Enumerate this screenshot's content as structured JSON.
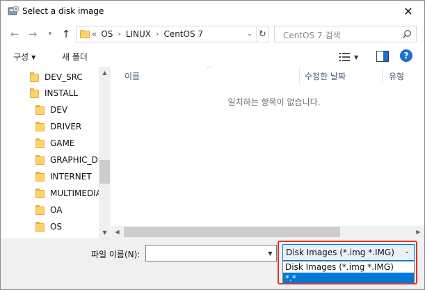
{
  "window": {
    "title": "Select a disk image",
    "close_glyph": "✕"
  },
  "nav": {
    "back_icon": "←",
    "forward_icon": "→",
    "recent_icon": "▾",
    "up_icon": "↑",
    "address": {
      "overflow": "«",
      "crumbs": [
        "OS",
        "LINUX",
        "CentOS 7"
      ],
      "separator": "›",
      "dropdown_icon": "⌄",
      "refresh_icon": "↻"
    },
    "search": {
      "placeholder": "CentOS 7 검색"
    }
  },
  "toolbar": {
    "organize_label": "구성",
    "organize_caret": "▼",
    "new_folder_label": "새 폴더",
    "view_caret": "▼",
    "help_label": "?"
  },
  "sidebar": {
    "items": [
      {
        "label": "DEV_SRC"
      },
      {
        "label": "INSTALL"
      },
      {
        "label": "DEV"
      },
      {
        "label": "DRIVER"
      },
      {
        "label": "GAME"
      },
      {
        "label": "GRAPHIC_DE"
      },
      {
        "label": "INTERNET"
      },
      {
        "label": "MULTIMEDIA"
      },
      {
        "label": "OA"
      },
      {
        "label": "OS"
      }
    ],
    "scroll_up": "▲",
    "scroll_down": "▼"
  },
  "filelist": {
    "columns": {
      "name": "이름",
      "date": "수정한 날짜",
      "type": "유형"
    },
    "sort_indicator": "^",
    "empty_message": "일치하는 항목이 없습니다.",
    "scroll_left": "◀",
    "scroll_right": "▶"
  },
  "bottom": {
    "filename_label": "파일 이름(N):",
    "filename_value": "",
    "filename_dd": "▼",
    "filetype_selected": "Disk Images (*.img *.IMG)",
    "filetype_caret": "⌄",
    "filetype_options": [
      "Disk Images (*.img *.IMG)",
      "*.*"
    ]
  },
  "colors": {
    "accent": "#0078d7",
    "highlight_box": "#e0302b",
    "folder": "#ffd36b"
  }
}
